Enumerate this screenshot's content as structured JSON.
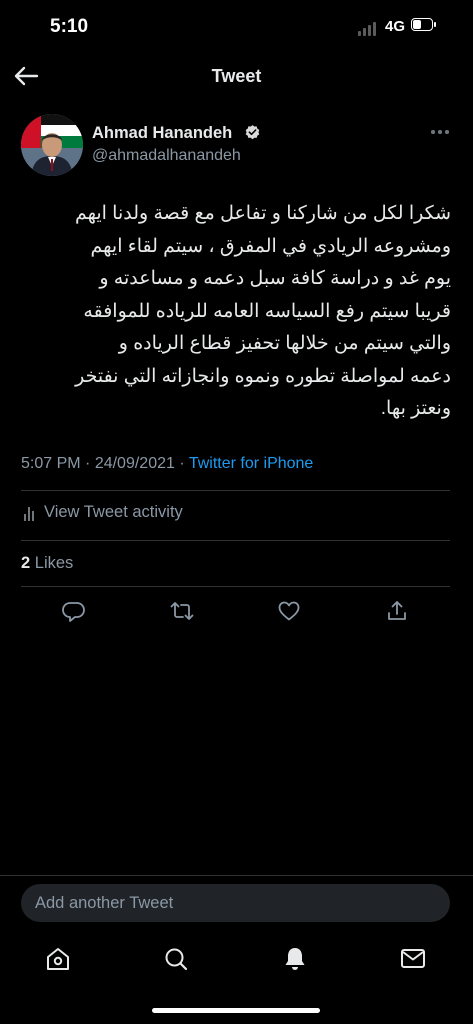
{
  "status_bar": {
    "time": "5:10",
    "network": "4G"
  },
  "header": {
    "title": "Tweet"
  },
  "author": {
    "name": "Ahmad Hanandeh",
    "handle": "@ahmadalhanandeh",
    "verified": true
  },
  "tweet": {
    "text": "شكرا لكل من شاركنا و تفاعل مع قصة ولدنا ايهم\nومشروعه الريادي في المفرق ، سيتم لقاء ايهم\nيوم غد و دراسة كافة سبل دعمه و مساعدته و\nقريبا سيتم رفع السياسه العامه للرياده للموافقه\nوالتي سيتم من خلالها تحفيز قطاع الرياده و\nدعمه لمواصلة تطوره ونموه وانجازاته التي نفتخر\nونعتز بها.",
    "time": "5:07 PM",
    "date": "24/09/2021",
    "source": "Twitter for iPhone",
    "activity_label": "View Tweet activity",
    "likes_count": "2",
    "likes_label": "Likes"
  },
  "reply": {
    "placeholder": "Add another Tweet"
  },
  "actions": [
    "reply-icon",
    "retweet-icon",
    "like-icon",
    "share-icon"
  ],
  "tabs": [
    "home-icon",
    "search-icon",
    "notifications-icon",
    "messages-icon"
  ],
  "colors": {
    "background": "#000000",
    "text": "#e7e9ea",
    "secondary": "#8b98a5",
    "link": "#1d9bf0",
    "divider": "#2f3336"
  }
}
